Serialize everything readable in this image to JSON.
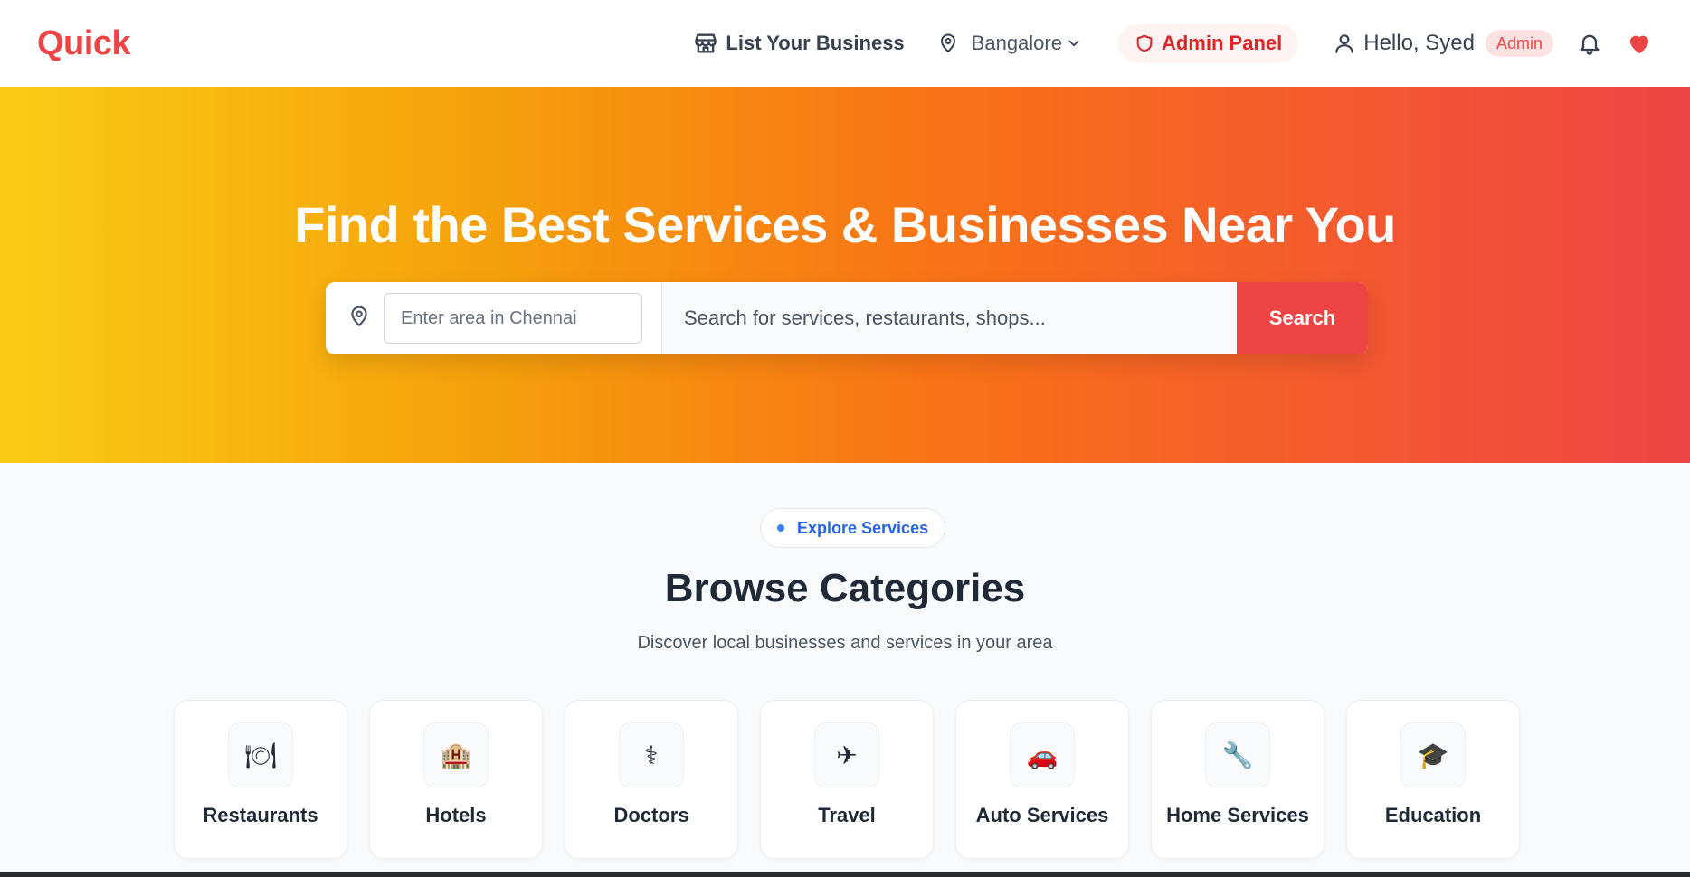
{
  "header": {
    "logo": "Quick",
    "list_business": "List Your Business",
    "city": "Bangalore",
    "admin_panel": "Admin Panel",
    "greeting": "Hello, Syed",
    "role_badge": "Admin",
    "icons": {
      "store": "store-icon",
      "location": "map-pin-icon",
      "chevron": "chevron-down-icon",
      "shield": "shield-icon",
      "user": "user-icon",
      "bell": "bell-icon",
      "heart": "heart-icon"
    },
    "accent_color": "#ef4444"
  },
  "hero": {
    "title": "Find the Best Services & Businesses Near You",
    "area_placeholder": "Enter area in Chennai",
    "search_placeholder": "Search for services, restaurants, shops...",
    "search_button": "Search",
    "gradient": [
      "#facc15",
      "#f97316",
      "#ef4444"
    ]
  },
  "categories_section": {
    "pill": "Explore Services",
    "title": "Browse Categories",
    "subtitle": "Discover local businesses and services in your area",
    "items": [
      {
        "label": "Restaurants",
        "icon": "🍽",
        "icon_name": "plate-icon"
      },
      {
        "label": "Hotels",
        "icon": "🏨",
        "icon_name": "hotel-icon"
      },
      {
        "label": "Doctors",
        "icon": "⚕",
        "icon_name": "doctor-icon"
      },
      {
        "label": "Travel",
        "icon": "✈",
        "icon_name": "airplane-icon"
      },
      {
        "label": "Auto Services",
        "icon": "🚗",
        "icon_name": "car-icon"
      },
      {
        "label": "Home Services",
        "icon": "🔧",
        "icon_name": "wrench-icon"
      },
      {
        "label": "Education",
        "icon": "🎓",
        "icon_name": "graduation-cap-icon"
      }
    ]
  }
}
